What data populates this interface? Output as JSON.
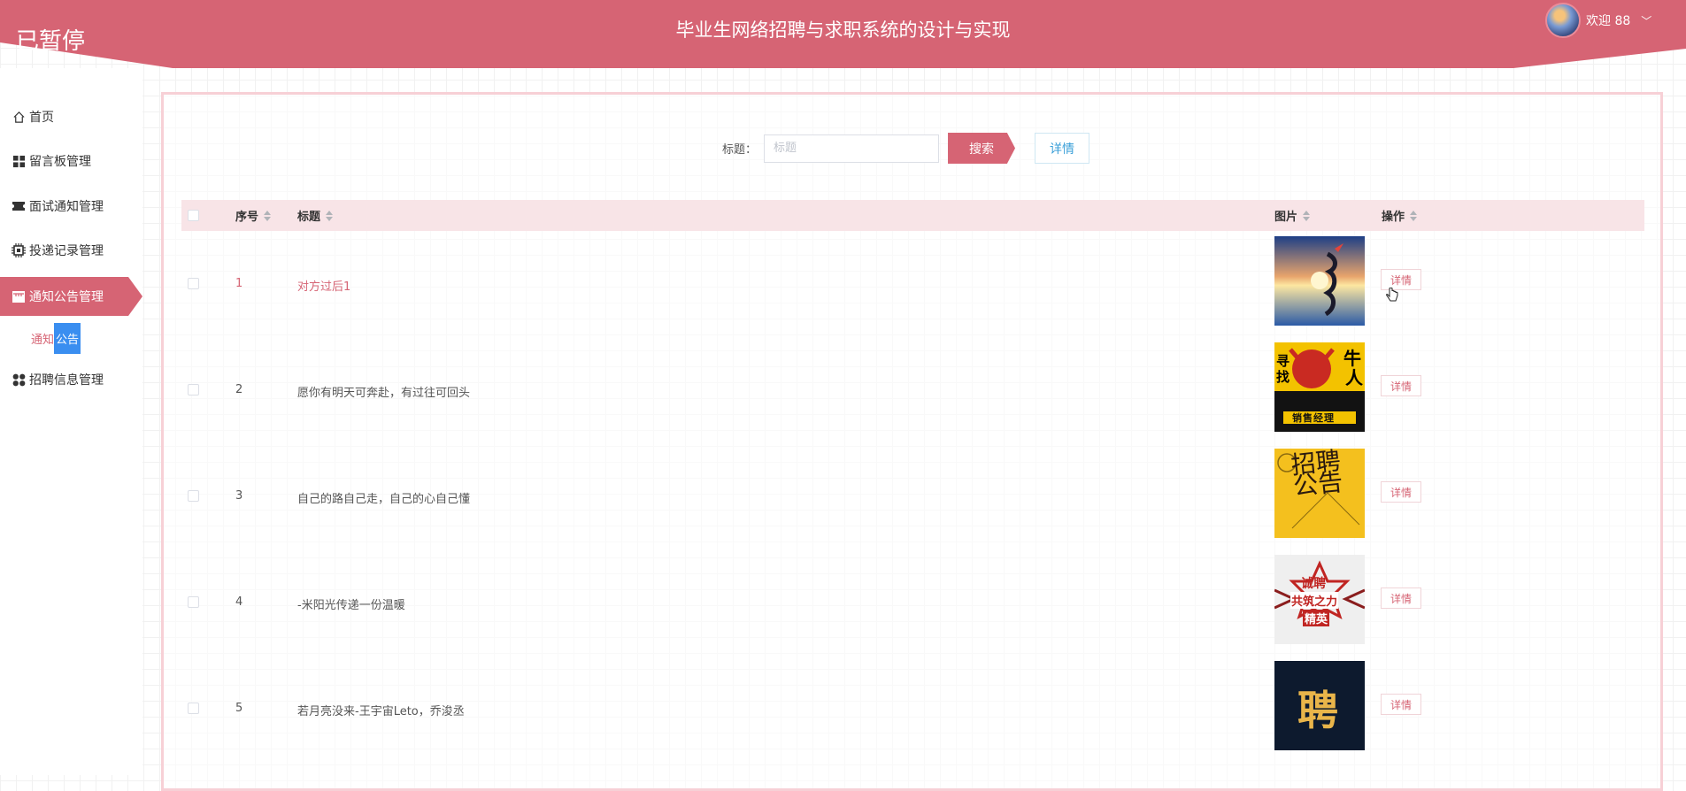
{
  "header": {
    "paused_label": "已暂停",
    "title": "毕业生网络招聘与求职系统的设计与实现",
    "user_greeting": "欢迎 88",
    "accent_color": "#d66474"
  },
  "sidebar": {
    "items": [
      {
        "label": "首页",
        "icon": "home-icon"
      },
      {
        "label": "留言板管理",
        "icon": "grid-icon"
      },
      {
        "label": "面试通知管理",
        "icon": "ticket-icon"
      },
      {
        "label": "投递记录管理",
        "icon": "chip-icon"
      },
      {
        "label": "通知公告管理",
        "icon": "store-icon",
        "active": true
      },
      {
        "label": "招聘信息管理",
        "icon": "apps-icon"
      }
    ],
    "sub_item": {
      "part1": "通知",
      "part2": "公告"
    }
  },
  "search": {
    "label": "标题：",
    "placeholder": "标题",
    "value": "",
    "search_button": "搜索",
    "detail_button": "详情"
  },
  "table": {
    "columns": {
      "index": "序号",
      "title": "标题",
      "image": "图片",
      "action": "操作"
    },
    "rows": [
      {
        "index": "1",
        "title": "对方过后1",
        "image": "sunset-reflection",
        "action": "详情"
      },
      {
        "index": "2",
        "title": "愿你有明天可奔赴，有过往可回头",
        "image": "hiring-poster-sales-manager",
        "action": "详情"
      },
      {
        "index": "3",
        "title": "自己的路自己走，自己的心自己懂",
        "image": "recruitment-notice-poster",
        "action": "详情"
      },
      {
        "index": "4",
        "title": "-米阳光传递一份温暖",
        "image": "hiring-badge-poster",
        "action": "详情"
      },
      {
        "index": "5",
        "title": "若月亮没来-王宇宙Leto，乔浚丞",
        "image": "gold-hiring-character",
        "action": "详情"
      }
    ],
    "image_texts": {
      "poster2": {
        "a": "寻",
        "b": "牛",
        "c": "人",
        "d": "找",
        "e": "销售经理"
      },
      "poster3": {
        "chars": "招聘公告"
      },
      "poster4": {
        "a": "诚聘",
        "b": "共筑之力",
        "c": "精英"
      },
      "poster5": {
        "char": "聘"
      }
    }
  }
}
